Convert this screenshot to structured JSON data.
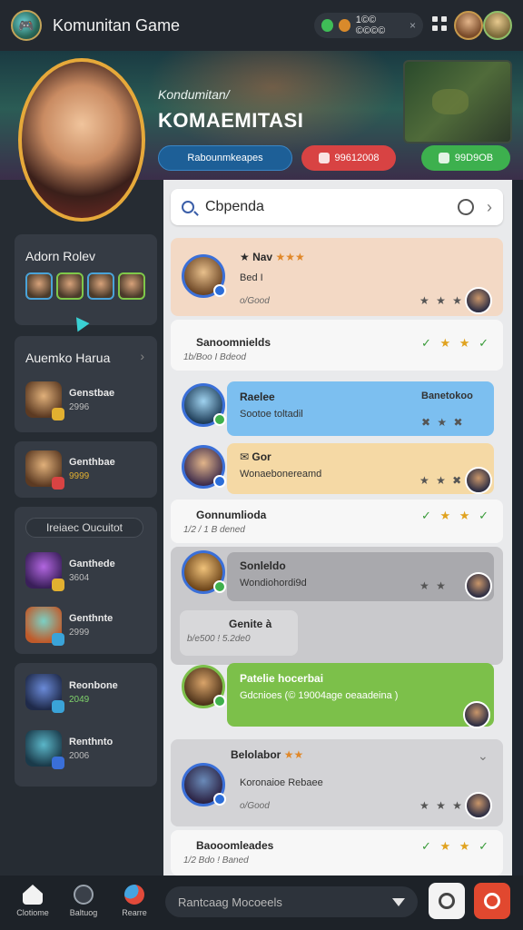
{
  "header": {
    "title": "Komunitan Game",
    "currency_value": "1©© ©©©©",
    "currency_close": "×",
    "logo_icon": "game-controller-icon"
  },
  "hero": {
    "subtitle": "Kondumitan/",
    "title": "KOMAEMITASI",
    "buttons": [
      {
        "label": "Rabounmkeapes",
        "color": "#1d5f97"
      },
      {
        "label": "99612008",
        "color": "#d84343"
      },
      {
        "label": "99D9OB",
        "color": "#3db04e"
      }
    ]
  },
  "sidebar": {
    "card1": {
      "heading": "Adorn Rolev"
    },
    "card2": {
      "heading": "Auemko Harua",
      "chevron": "›"
    },
    "items_a": [
      {
        "name": "Genstbae",
        "sub": "2996"
      },
      {
        "name": "Genthbae",
        "sub": "9999"
      }
    ],
    "pill_label": "Ireiaec Oucuitot",
    "items_b": [
      {
        "name": "Ganthede",
        "sub": "3604"
      },
      {
        "name": "Genthnte",
        "sub": "2999"
      }
    ],
    "items_c": [
      {
        "name": "Reonbone",
        "sub": "2049"
      },
      {
        "name": "Renthnto",
        "sub": "2006"
      }
    ]
  },
  "feed": {
    "search_placeholder": "Cbpenda",
    "search_chevron": "›",
    "posts": [
      {
        "title": "Nav",
        "body": "Bed I",
        "meta": "o/Good",
        "stats": "★ ★ ★",
        "stars": "★ ★ ★"
      },
      {
        "title": "Sanoomnields",
        "meta": "1b/Boo I Bdeod",
        "stars_text": "★ ★"
      },
      {
        "title": "Raelee",
        "body": "Sootoe toltadil",
        "right": "Banetokoo",
        "stats": "✖ ★ ✖"
      },
      {
        "title": "Gor",
        "body": "Wonaebonereamd",
        "stats": "★ ★ ✖"
      },
      {
        "title": "Gonnumlioda",
        "meta": "1/2 / 1 B dened"
      },
      {
        "title": "Sonleldo",
        "body": "Wondiohordi9d",
        "stats": "★ ★"
      },
      {
        "title": "Genite à",
        "meta": "b/e500 ! 5.2de0"
      },
      {
        "title": "Patelie hocerbai",
        "body": "Gdcnioes (© 19004age oeaadeina )"
      },
      {
        "title": "Belolabor",
        "body": "Koronaioe Rebaee",
        "meta": "o/Good",
        "stats": "★ ★ ★"
      },
      {
        "title": "Baooomleades",
        "meta": "1/2 Bdo ! Baned"
      }
    ]
  },
  "bottom_nav": {
    "items": [
      {
        "label": "Clotiome",
        "icon": "home-icon"
      },
      {
        "label": "Baltuog",
        "icon": "compass-icon"
      },
      {
        "label": "Rearre",
        "icon": "chat-bubble-icon"
      }
    ],
    "chat_placeholder": "Rantcaag Mocoeels"
  }
}
